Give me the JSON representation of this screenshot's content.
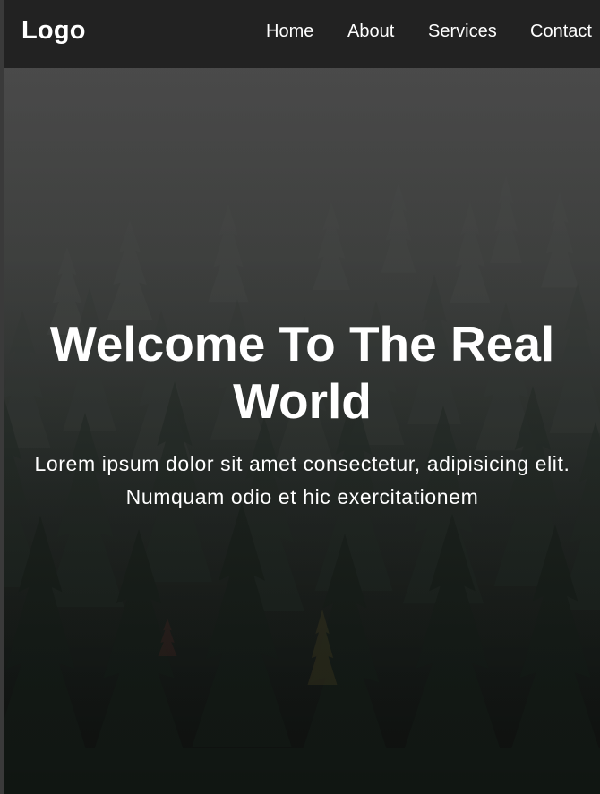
{
  "navbar": {
    "logo": "Logo",
    "links": [
      {
        "label": "Home"
      },
      {
        "label": "About"
      },
      {
        "label": "Services"
      },
      {
        "label": "Contact"
      }
    ]
  },
  "hero": {
    "title": "Welcome To The Real World",
    "text": "Lorem ipsum dolor sit amet consectetur, adipisicing elit. Numquam odio et hic exercitationem",
    "background": "misty-pine-forest-image"
  },
  "colors": {
    "navbar_bg": "#222222",
    "text": "#ffffff",
    "overlay": "#141414"
  }
}
